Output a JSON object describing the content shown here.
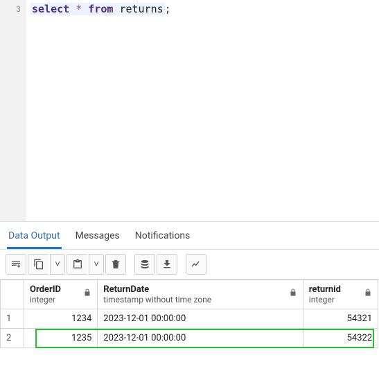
{
  "editor": {
    "line_number": "3",
    "tokens": {
      "select": "select",
      "star": "*",
      "from": "from",
      "table": "returns",
      "semi": ";"
    }
  },
  "tabs": {
    "data_output": "Data Output",
    "messages": "Messages",
    "notifications": "Notifications"
  },
  "toolbar": {
    "add_row": "add-row",
    "copy": "copy",
    "copy_menu": "▾",
    "paste": "paste",
    "paste_menu": "▾",
    "delete": "delete",
    "save": "save-data",
    "download": "download",
    "chart": "chart"
  },
  "columns": [
    {
      "name": "OrderID",
      "type": "integer",
      "align": "num"
    },
    {
      "name": "ReturnDate",
      "type": "timestamp without time zone",
      "align": "text"
    },
    {
      "name": "returnid",
      "type": "integer",
      "align": "num"
    }
  ],
  "rows": [
    {
      "n": "1",
      "cells": [
        "1234",
        "2023-12-01 00:00:00",
        "54321"
      ],
      "highlight": false
    },
    {
      "n": "2",
      "cells": [
        "1235",
        "2023-12-01 00:00:00",
        "54322"
      ],
      "highlight": true
    }
  ]
}
